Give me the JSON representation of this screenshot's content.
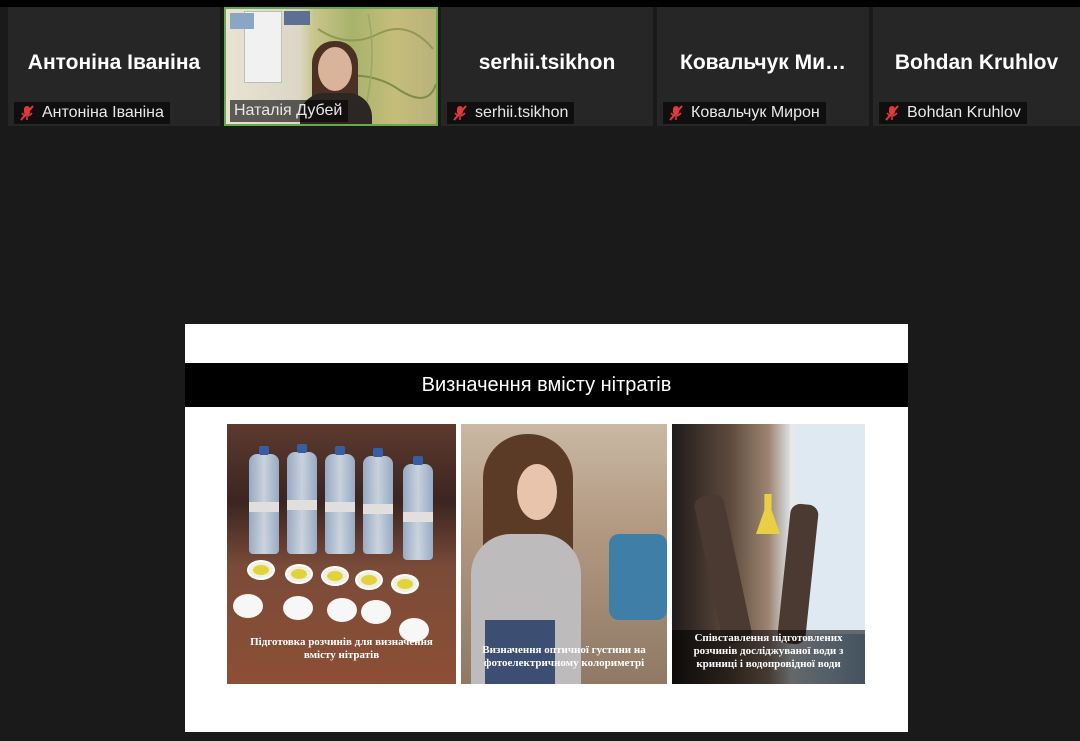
{
  "participants": [
    {
      "display_name": "Антоніна Іваніна",
      "label": "Антоніна Іваніна",
      "muted": true,
      "video": false
    },
    {
      "display_name": "",
      "label": "Наталія Дубей",
      "muted": false,
      "video": true
    },
    {
      "display_name": "serhii.tsikhon",
      "label": "serhii.tsikhon",
      "muted": true,
      "video": false
    },
    {
      "display_name": "Ковальчук  Ми…",
      "label": "Ковальчук Мирон",
      "muted": true,
      "video": false
    },
    {
      "display_name": "Bohdan Kruhlov",
      "label": "Bohdan Kruhlov",
      "muted": true,
      "video": false
    }
  ],
  "slide": {
    "title": "Визначення вмісту нітратів",
    "captions": [
      "Підготовка розчинів для визначення вмісту нітратів",
      "Визначення оптичної густини на фотоелектричному колориметрі",
      "Співставлення підготовлених розчинів досліджуваної води з криниці і водопровідної води"
    ]
  },
  "colors": {
    "active_speaker_border": "#6aa84f",
    "muted_icon": "#e03a3a",
    "tile_bg": "#262626",
    "app_bg": "#1a1a1a"
  }
}
